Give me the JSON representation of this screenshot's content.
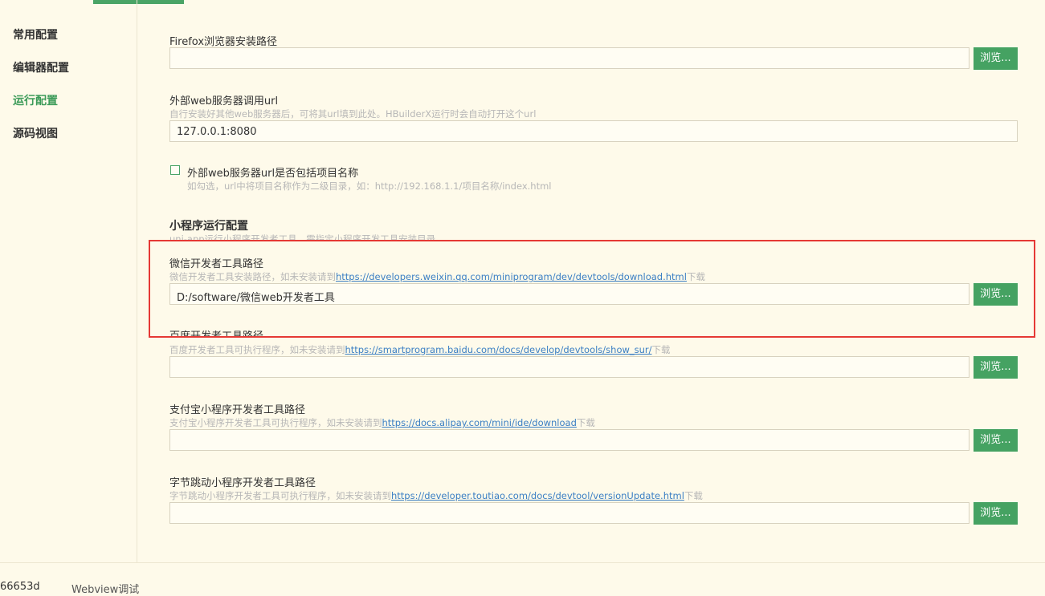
{
  "sidebar": {
    "items": [
      {
        "label": "常用配置",
        "active": false
      },
      {
        "label": "编辑器配置",
        "active": false
      },
      {
        "label": "运行配置",
        "active": true
      },
      {
        "label": "源码视图",
        "active": false
      }
    ]
  },
  "firefox": {
    "label": "Firefox浏览器安装路径",
    "value": "",
    "button": "浏览..."
  },
  "webserver": {
    "label": "外部web服务器调用url",
    "hint": "自行安装好其他web服务器后，可将其url填到此处。HBuilderX运行时会自动打开这个url",
    "value": "127.0.0.1:8080"
  },
  "include_project": {
    "label": "外部web服务器url是否包括项目名称",
    "hint": "如勾选，url中将项目名称作为二级目录，如：http://192.168.1.1/项目名称/index.html",
    "checked": false
  },
  "miniprogram": {
    "title": "小程序运行配置",
    "subtitle": "uni-app运行小程序开发者工具，需指定小程序开发工具安装目录"
  },
  "weixin": {
    "label": "微信开发者工具路径",
    "hint_prefix": "微信开发者工具安装路径，如未安装请到",
    "link": "https://developers.weixin.qq.com/miniprogram/dev/devtools/download.html",
    "hint_suffix": "下载",
    "value": "D:/software/微信web开发者工具",
    "button": "浏览..."
  },
  "baidu": {
    "label": "百度开发者工具路径",
    "hint_prefix": "百度开发者工具可执行程序，如未安装请到",
    "link": "https://smartprogram.baidu.com/docs/develop/devtools/show_sur/",
    "hint_suffix": "下载",
    "value": "",
    "button": "浏览..."
  },
  "alipay": {
    "label": "支付宝小程序开发者工具路径",
    "hint_prefix": "支付宝小程序开发者工具可执行程序，如未安装请到",
    "link": "https://docs.alipay.com/mini/ide/download",
    "hint_suffix": "下载",
    "value": "",
    "button": "浏览..."
  },
  "toutiao": {
    "label": "字节跳动小程序开发者工具路径",
    "hint_prefix": "字节跳动小程序开发者工具可执行程序，如未安装请到",
    "link": "https://developer.toutiao.com/docs/devtool/versionUpdate.html",
    "hint_suffix": "下载",
    "value": "",
    "button": "浏览..."
  },
  "bottom": {
    "left_text": "66653d",
    "tab": "Webview调试"
  },
  "colors": {
    "accent": "#45a262",
    "background": "#fefaea",
    "highlight": "#e53935",
    "link": "#3b7fc4"
  }
}
